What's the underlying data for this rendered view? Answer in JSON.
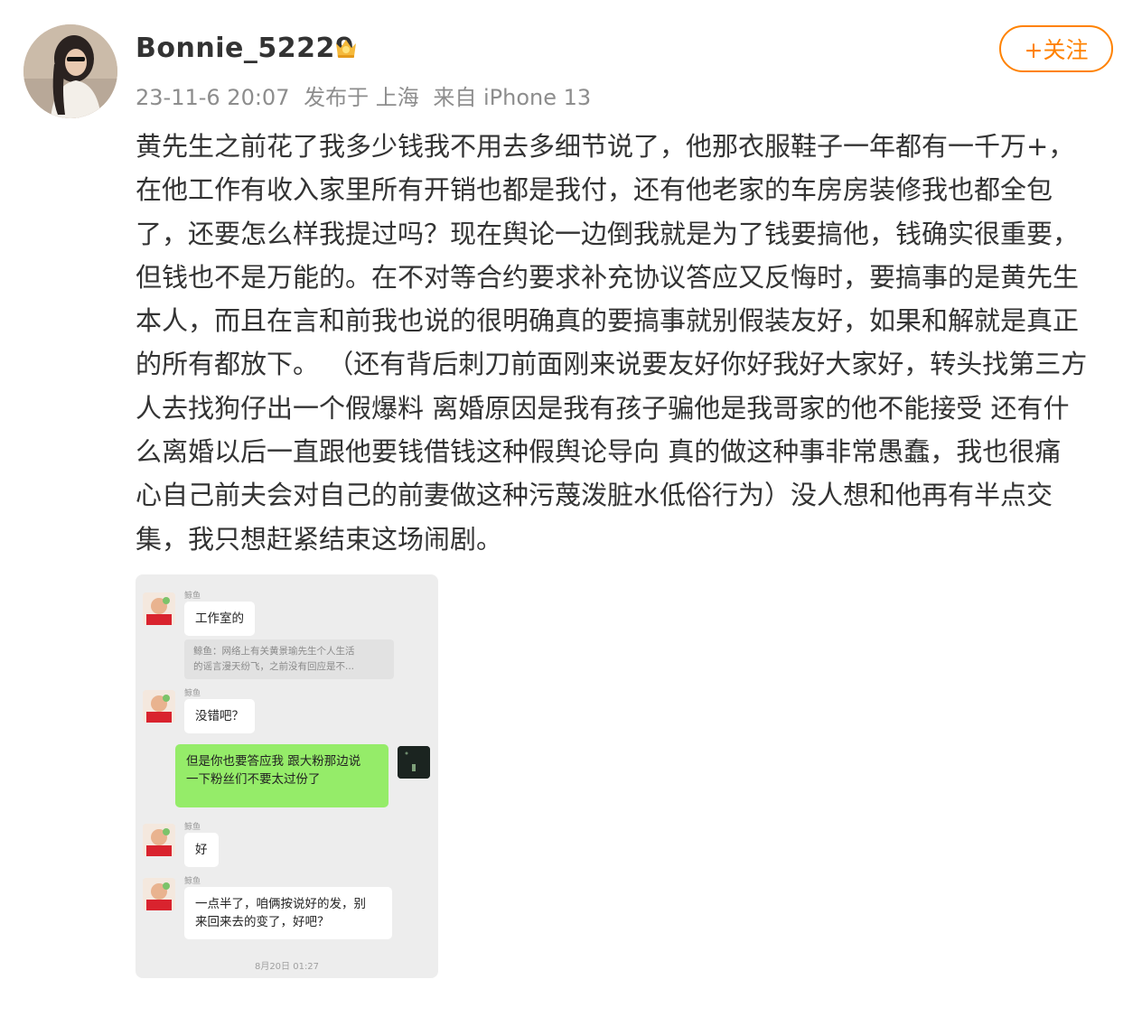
{
  "post": {
    "username": "Bonnie_52229",
    "timestamp": "23-11-6 20:07",
    "published_at_label": "发布于 上海",
    "source_label": "来自 iPhone 13",
    "follow_label": "+关注",
    "text_lines": [
      "黄先生之前花了我多少钱我不用去多细节说了，他那衣服鞋子一年都有一千万+，",
      "在他工作有收入家里所有开销也都是我付，还有他老家的车房房装修我也都全包",
      "了，还要怎么样我提过吗？现在舆论一边倒我就是为了钱要搞他，钱确实很重要，",
      "但钱也不是万能的。在不对等合约要求补充协议答应又反悔时，要搞事的是黄先生",
      "本人，而且在言和前我也说的很明确真的要搞事就别假装友好，如果和解就是真正",
      "的所有都放下。 （还有背后刺刀前面刚来说要友好你好我好大家好，转头找第三方",
      "人去找狗仔出一个假爆料 离婚原因是我有孩子骗他是我哥家的他不能接受 还有什",
      "么离婚以后一直跟他要钱借钱这种假舆论导向 真的做这种事非常愚蠢，我也很痛",
      "心自己前夫会对自己的前妻做这种污蔑泼脏水低俗行为）没人想和他再有半点交",
      "集，我只想赶紧结束这场闹剧。"
    ]
  },
  "chat": {
    "messages": [
      {
        "sender": "鲸鱼",
        "text": "工作室的"
      },
      {
        "quote_line1": "鲸鱼：网络上有关黄景瑜先生个人生活",
        "quote_line2": "的谣言漫天纷飞，之前没有回应是不..."
      },
      {
        "sender": "鲸鱼",
        "text": "没错吧？"
      },
      {
        "line1": "但是你也要答应我 跟大粉那边说",
        "line2": "一下粉丝们不要太过份了"
      },
      {
        "sender": "鲸鱼",
        "text": "好"
      },
      {
        "sender": "鲸鱼",
        "line1": "一点半了，咱俩按说好的发，别",
        "line2": "来回来去的变了，好吧？"
      }
    ],
    "time": "8月20日 01:27"
  },
  "colors": {
    "accent": "#ff8200",
    "text": "#333333",
    "meta": "#8d8d8d",
    "chat_bg": "#ededed",
    "green_bubble": "#95ec69"
  }
}
